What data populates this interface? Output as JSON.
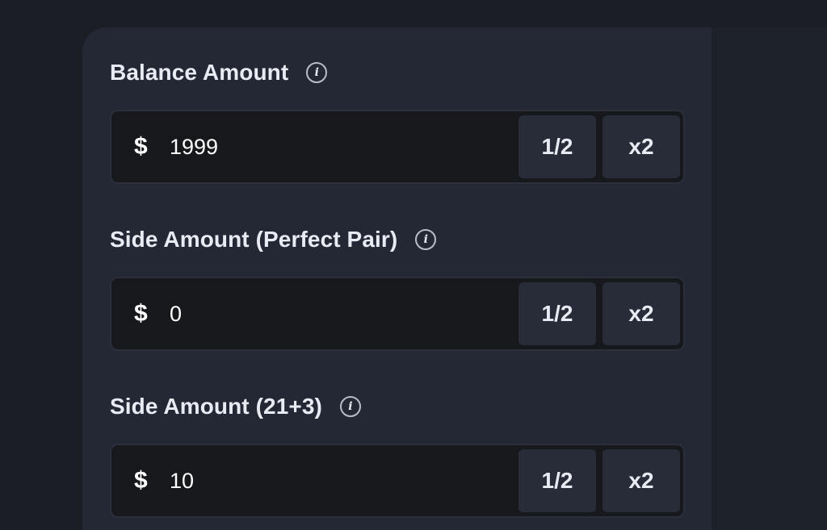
{
  "fields": [
    {
      "label": "Balance Amount",
      "info_icon": "i",
      "currency": "$",
      "value": "1999",
      "half_label": "1/2",
      "double_label": "x2"
    },
    {
      "label": "Side Amount (Perfect Pair)",
      "info_icon": "i",
      "currency": "$",
      "value": "0",
      "half_label": "1/2",
      "double_label": "x2"
    },
    {
      "label": "Side Amount (21+3)",
      "info_icon": "i",
      "currency": "$",
      "value": "10",
      "half_label": "1/2",
      "double_label": "x2"
    }
  ],
  "colors": {
    "background": "#1b1e25",
    "panel": "#232834",
    "input": "#16181c",
    "button": "#272c38",
    "text": "#e8ebf2"
  }
}
